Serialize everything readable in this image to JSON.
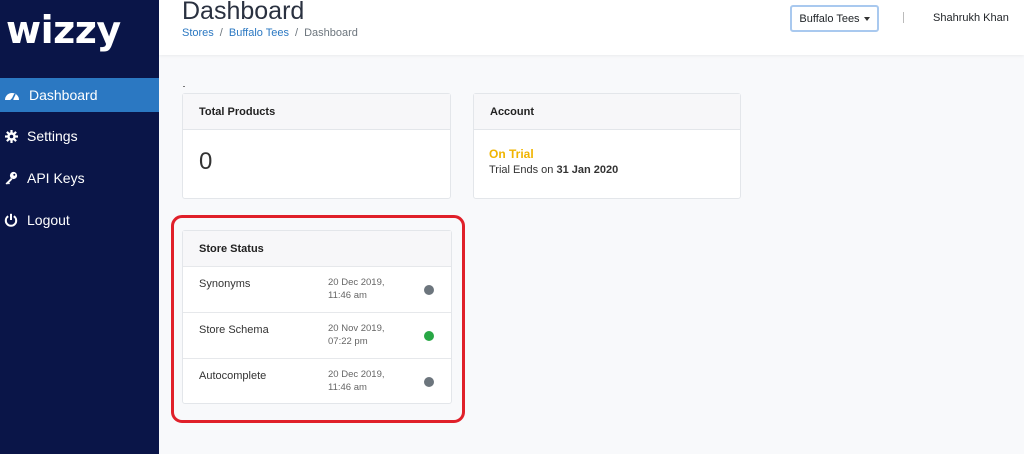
{
  "app": {
    "logo_text": "wizzy"
  },
  "sidebar": {
    "items": [
      {
        "label": "Dashboard",
        "icon": "dashboard-icon",
        "active": true
      },
      {
        "label": "Settings",
        "icon": "gear-icon",
        "active": false
      },
      {
        "label": "API Keys",
        "icon": "key-icon",
        "active": false
      },
      {
        "label": "Logout",
        "icon": "power-icon",
        "active": false
      }
    ]
  },
  "header": {
    "title": "Dashboard",
    "breadcrumb": [
      "Stores",
      "Buffalo Tees",
      "Dashboard"
    ],
    "store_select": "Buffalo Tees",
    "user_name": "Shahrukh Khan"
  },
  "cards": {
    "total_products": {
      "title": "Total Products",
      "value": "0"
    },
    "account": {
      "title": "Account",
      "status": "On Trial",
      "ends_prefix": "Trial Ends on",
      "ends_date": "31 Jan 2020"
    },
    "store_status": {
      "title": "Store Status",
      "rows": [
        {
          "name": "Synonyms",
          "date": "20 Dec 2019,",
          "time": "11:46 am",
          "status_color": "#6c757d"
        },
        {
          "name": "Store Schema",
          "date": "20 Nov 2019,",
          "time": "07:22 pm",
          "status_color": "#28a745"
        },
        {
          "name": "Autocomplete",
          "date": "20 Dec 2019,",
          "time": "11:46 am",
          "status_color": "#6c757d"
        }
      ]
    }
  },
  "colors": {
    "sidebar_bg": "#0a1548",
    "active_nav": "#2b78c2",
    "trial": "#f0b400",
    "highlight": "#e0202a"
  }
}
